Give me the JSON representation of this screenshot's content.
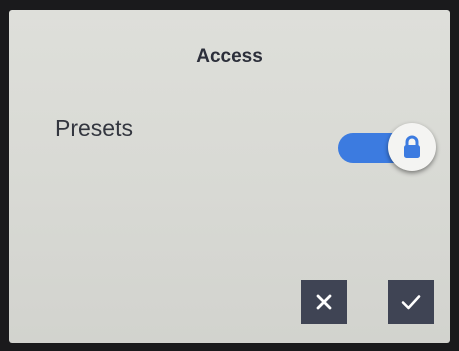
{
  "dialog": {
    "title": "Access"
  },
  "settings": [
    {
      "label": "Presets",
      "enabled": true,
      "locked": true,
      "toggle_color": "#3c7be0",
      "icon": "lock-icon"
    }
  ],
  "actions": {
    "cancel_icon": "close-icon",
    "confirm_icon": "checkmark-icon"
  },
  "colors": {
    "screen_background": "#dcddd8",
    "button_background": "#3f4454",
    "text": "#2c2f3a"
  }
}
